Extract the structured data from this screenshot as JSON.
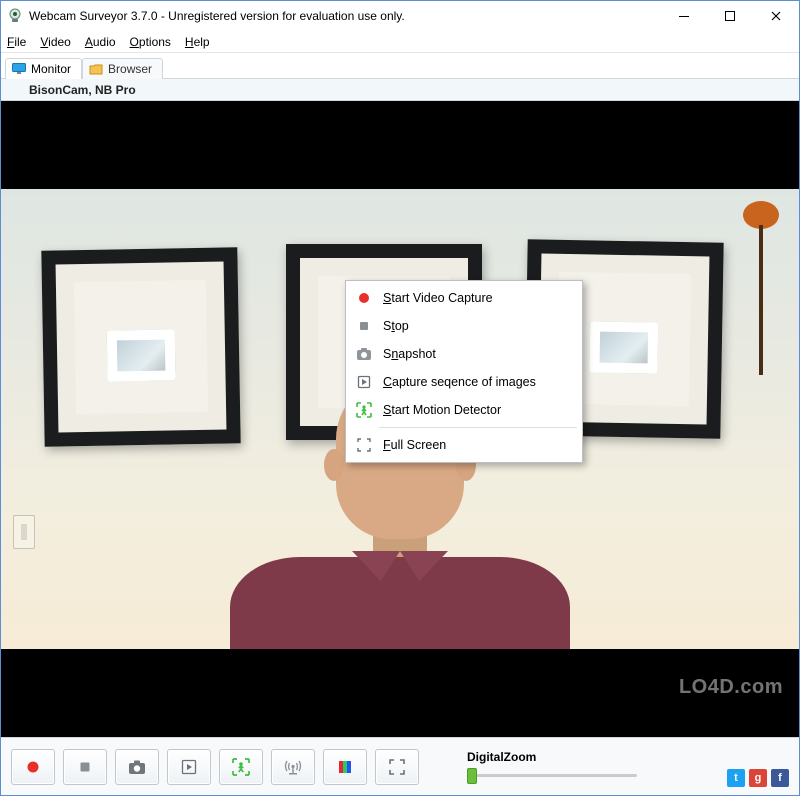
{
  "window": {
    "title": "Webcam Surveyor 3.7.0 - Unregistered version for evaluation use only."
  },
  "menu": {
    "file": "File",
    "video": "Video",
    "audio": "Audio",
    "options": "Options",
    "help": "Help"
  },
  "tabs": {
    "monitor": "Monitor",
    "browser": "Browser"
  },
  "camera": {
    "name": "BisonCam, NB Pro"
  },
  "context_menu": {
    "start_video_capture": "Start Video Capture",
    "stop": "Stop",
    "snapshot": "Snapshot",
    "capture_sequence": "Capture seqence of images",
    "start_motion_detector": "Start Motion Detector",
    "full_screen": "Full Screen"
  },
  "toolbar": {
    "record": "Record",
    "stop": "Stop",
    "snapshot": "Snapshot",
    "capture_sequence": "Capture sequence of images",
    "motion_detect": "Start Motion Detector",
    "broadcast": "Broadcast",
    "color": "Color Settings",
    "fullscreen": "Full Screen"
  },
  "zoom": {
    "label": "DigitalZoom"
  },
  "watermark": "LO4D.com",
  "icons": {
    "app": "webcam-icon",
    "monitor_tab": "monitor-icon",
    "browser_tab": "folder-icon"
  },
  "colors": {
    "record_red": "#e8302a",
    "motion_green": "#3fbf3f",
    "slider_thumb": "#6cbf3a"
  }
}
